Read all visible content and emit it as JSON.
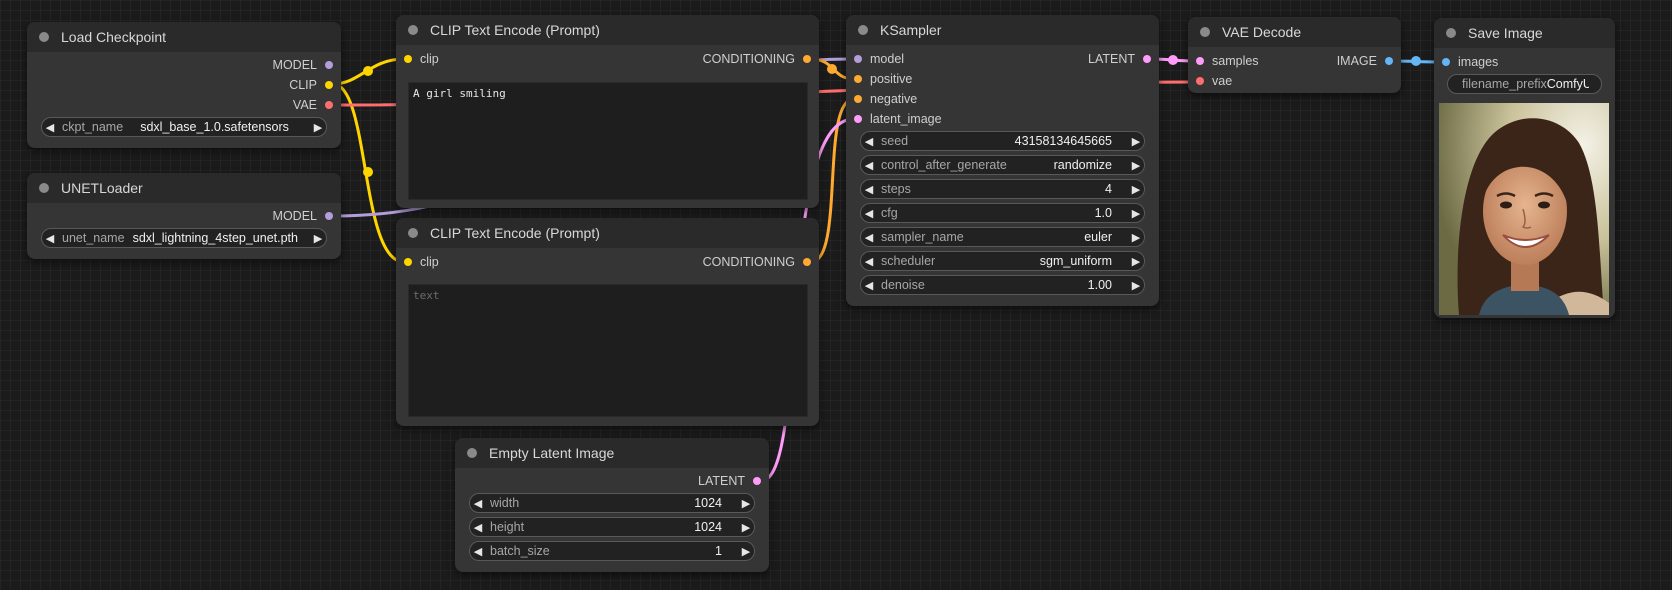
{
  "colors": {
    "clip": "#ffd500",
    "model": "#b39ddb",
    "vae": "#ff6e6e",
    "conditioning": "#ffa931",
    "latent": "#ff9cf9",
    "image": "#64b5f6"
  },
  "nodes": {
    "load_checkpoint": {
      "title": "Load Checkpoint",
      "outputs": [
        "MODEL",
        "CLIP",
        "VAE"
      ],
      "widget": {
        "name": "ckpt_name",
        "value": "sdxl_base_1.0.safetensors"
      }
    },
    "unet_loader": {
      "title": "UNETLoader",
      "outputs": [
        "MODEL"
      ],
      "widget": {
        "name": "unet_name",
        "value": "sdxl_lightning_4step_unet.pth"
      }
    },
    "clip_text_pos": {
      "title": "CLIP Text Encode (Prompt)",
      "input": "clip",
      "output": "CONDITIONING",
      "text": "A girl smiling"
    },
    "clip_text_neg": {
      "title": "CLIP Text Encode (Prompt)",
      "input": "clip",
      "output": "CONDITIONING",
      "placeholder": "text"
    },
    "empty_latent": {
      "title": "Empty Latent Image",
      "output": "LATENT",
      "widgets": [
        {
          "name": "width",
          "value": "1024"
        },
        {
          "name": "height",
          "value": "1024"
        },
        {
          "name": "batch_size",
          "value": "1"
        }
      ]
    },
    "ksampler": {
      "title": "KSampler",
      "inputs": [
        "model",
        "positive",
        "negative",
        "latent_image"
      ],
      "output": "LATENT",
      "widgets": [
        {
          "name": "seed",
          "value": "43158134645665"
        },
        {
          "name": "control_after_generate",
          "value": "randomize"
        },
        {
          "name": "steps",
          "value": "4"
        },
        {
          "name": "cfg",
          "value": "1.0"
        },
        {
          "name": "sampler_name",
          "value": "euler"
        },
        {
          "name": "scheduler",
          "value": "sgm_uniform"
        },
        {
          "name": "denoise",
          "value": "1.00"
        }
      ]
    },
    "vae_decode": {
      "title": "VAE Decode",
      "inputs": [
        "samples",
        "vae"
      ],
      "output": "IMAGE"
    },
    "save_image": {
      "title": "Save Image",
      "input": "images",
      "widget": {
        "name": "filename_prefix",
        "value": "ComfyUI"
      }
    }
  }
}
